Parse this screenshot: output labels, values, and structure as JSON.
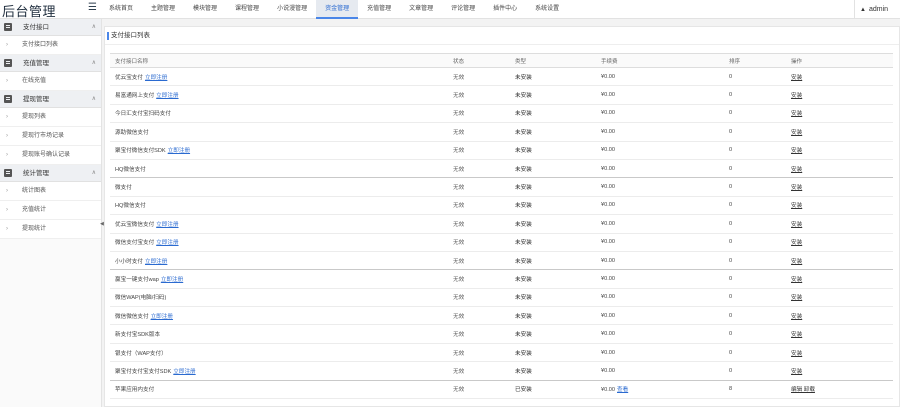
{
  "app": {
    "title": "后台管理",
    "user": "admin"
  },
  "nav": [
    {
      "label": "系统首页",
      "active": false
    },
    {
      "label": "主题管理",
      "active": false
    },
    {
      "label": "模块管理",
      "active": false
    },
    {
      "label": "课程管理",
      "active": false
    },
    {
      "label": "小说漫管理",
      "active": false
    },
    {
      "label": "资金管理",
      "active": true
    },
    {
      "label": "充值管理",
      "active": false
    },
    {
      "label": "文章管理",
      "active": false
    },
    {
      "label": "评论管理",
      "active": false
    },
    {
      "label": "插件中心",
      "active": false
    },
    {
      "label": "系统设置",
      "active": false
    }
  ],
  "sidebar": [
    {
      "label": "支付接口",
      "items": [
        "支付接口列表"
      ]
    },
    {
      "label": "充值管理",
      "items": [
        "在线充值"
      ]
    },
    {
      "label": "提现管理",
      "items": [
        "提现列表",
        "提现行市场记录",
        "提现账号确认记录"
      ]
    },
    {
      "label": "统计管理",
      "items": [
        "统计图表",
        "充值统计",
        "提现统计"
      ]
    }
  ],
  "main": {
    "title": "支付接口列表"
  },
  "table": {
    "headers": [
      "支付接口名称",
      "状态",
      "类型",
      "手续费",
      "排序",
      "操作"
    ],
    "rows": [
      {
        "name": "优云宝支付",
        "link": "立即注册",
        "status": "无效",
        "type": "未安装",
        "fee": "¥0.00",
        "fee_link": "",
        "sort": "0",
        "op": "安装"
      },
      {
        "name": "易富通网上支付",
        "link": "立即注册",
        "status": "无效",
        "type": "未安装",
        "fee": "¥0.00",
        "fee_link": "",
        "sort": "0",
        "op": "安装"
      },
      {
        "name": "今日汇支付宝扫码支付",
        "link": "",
        "status": "无效",
        "type": "未安装",
        "fee": "¥0.00",
        "fee_link": "",
        "sort": "0",
        "op": "安装"
      },
      {
        "name": "源助微信支付",
        "link": "",
        "status": "无效",
        "type": "未安装",
        "fee": "¥0.00",
        "fee_link": "",
        "sort": "0",
        "op": "安装"
      },
      {
        "name": "聚宝付微信支付SDK",
        "link": "立即注册",
        "status": "无效",
        "type": "未安装",
        "fee": "¥0.00",
        "fee_link": "",
        "sort": "0",
        "op": "安装"
      },
      {
        "name": "HQ微信支付",
        "link": "",
        "status": "无效",
        "type": "未安装",
        "fee": "¥0.00",
        "fee_link": "",
        "sort": "0",
        "op": "安装"
      },
      {
        "name": "微支付",
        "link": "",
        "status": "无效",
        "type": "未安装",
        "fee": "¥0.00",
        "fee_link": "",
        "sort": "0",
        "op": "安装"
      },
      {
        "name": "HQ微信支付",
        "link": "",
        "status": "无效",
        "type": "未安装",
        "fee": "¥0.00",
        "fee_link": "",
        "sort": "0",
        "op": "安装"
      },
      {
        "name": "优云宝微信支付",
        "link": "立即注册",
        "status": "无效",
        "type": "未安装",
        "fee": "¥0.00",
        "fee_link": "",
        "sort": "0",
        "op": "安装"
      },
      {
        "name": "微信支付宝支付",
        "link": "立即注册",
        "status": "无效",
        "type": "未安装",
        "fee": "¥0.00",
        "fee_link": "",
        "sort": "0",
        "op": "安装"
      },
      {
        "name": "小小时支付",
        "link": "立即注册",
        "status": "无效",
        "type": "未安装",
        "fee": "¥0.00",
        "fee_link": "",
        "sort": "0",
        "op": "安装"
      },
      {
        "name": "赢宝一键支付wap",
        "link": "立即注册",
        "status": "无效",
        "type": "未安装",
        "fee": "¥0.00",
        "fee_link": "",
        "sort": "0",
        "op": "安装"
      },
      {
        "name": "微信WAP(电脑/扫码)",
        "link": "",
        "status": "无效",
        "type": "未安装",
        "fee": "¥0.00",
        "fee_link": "",
        "sort": "0",
        "op": "安装"
      },
      {
        "name": "微信微信支付",
        "link": "立即注册",
        "status": "无效",
        "type": "未安装",
        "fee": "¥0.00",
        "fee_link": "",
        "sort": "0",
        "op": "安装"
      },
      {
        "name": "新支付宝SDK版本",
        "link": "",
        "status": "无效",
        "type": "未安装",
        "fee": "¥0.00",
        "fee_link": "",
        "sort": "0",
        "op": "安装"
      },
      {
        "name": "银支付（WAP支付）",
        "link": "",
        "status": "无效",
        "type": "未安装",
        "fee": "¥0.00",
        "fee_link": "",
        "sort": "0",
        "op": "安装"
      },
      {
        "name": "聚宝付支付宝支付SDK",
        "link": "立即注册",
        "status": "无效",
        "type": "未安装",
        "fee": "¥0.00",
        "fee_link": "",
        "sort": "0",
        "op": "安装"
      },
      {
        "name": "苹果应用内支付",
        "link": "",
        "status": "无效",
        "type": "已安装",
        "fee": "¥0.00",
        "fee_link": "查看",
        "sort": "8",
        "op": "编辑 卸载"
      }
    ]
  }
}
